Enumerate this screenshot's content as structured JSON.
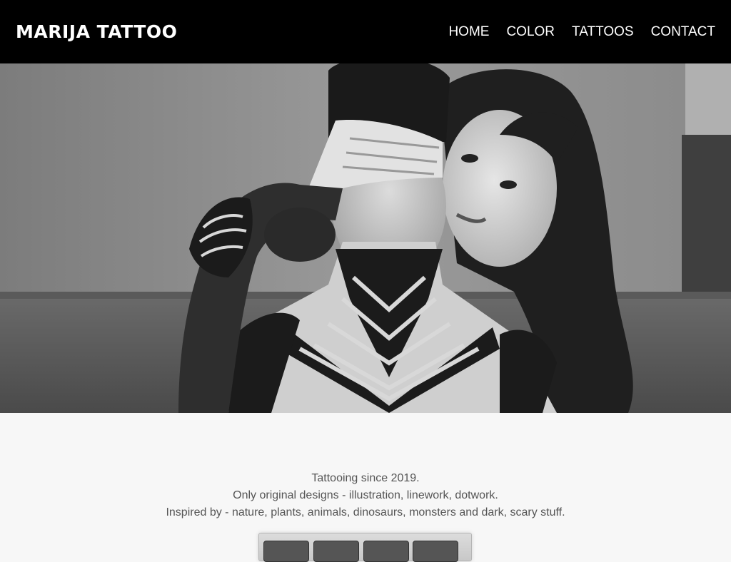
{
  "header": {
    "logo": "MARIJA TATTOO",
    "nav": [
      {
        "label": "HOME"
      },
      {
        "label": "COLOR"
      },
      {
        "label": "TATTOOS"
      },
      {
        "label": "CONTACT"
      }
    ]
  },
  "intro": {
    "lines": [
      "Tattooing since 2019.",
      "Only original designs - illustration, linework, dotwork.",
      "Inspired by - nature, plants, animals, dinosaurs, monsters and dark, scary stuff."
    ]
  },
  "colors": {
    "header_bg": "#000000",
    "header_text": "#ffffff",
    "page_bg": "#f7f7f7",
    "body_text": "#555555"
  }
}
